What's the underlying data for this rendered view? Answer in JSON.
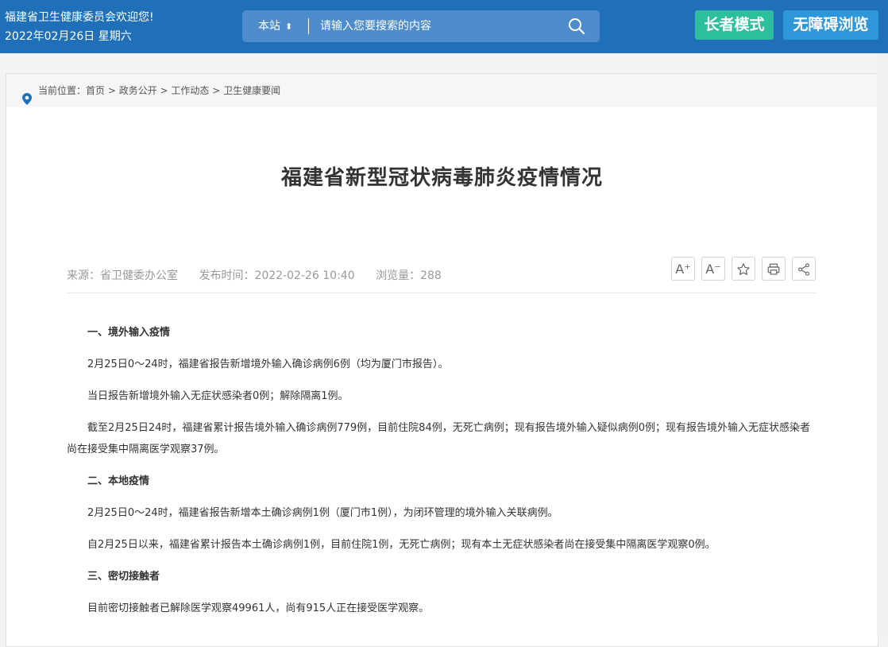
{
  "header": {
    "welcome": "福建省卫生健康委员会欢迎您!",
    "date": "2022年02月26日 星期六",
    "search_scope": "本站",
    "search_placeholder": "请输入您要搜索的内容",
    "elder_mode": "长者模式",
    "accessible": "无障碍浏览"
  },
  "breadcrumb": {
    "prefix": "当前位置：",
    "items": [
      "首页",
      "政务公开",
      "工作动态",
      "卫生健康要闻"
    ],
    "sep": " > "
  },
  "article": {
    "title": "福建省新型冠状病毒肺炎疫情情况",
    "source": "来源：省卫健委办公室",
    "published": "发布时间：2022-02-26 10:40",
    "views": "浏览量：288",
    "paragraphs": [
      {
        "type": "head",
        "text": "一、境外输入疫情"
      },
      {
        "type": "body",
        "text": "2月25日0～24时，福建省报告新增境外输入确诊病例6例（均为厦门市报告）。"
      },
      {
        "type": "body",
        "text": "当日报告新增境外输入无症状感染者0例；解除隔离1例。"
      },
      {
        "type": "body",
        "text": "截至2月25日24时，福建省累计报告境外输入确诊病例779例，目前住院84例，无死亡病例；现有报告境外输入疑似病例0例；现有报告境外输入无症状感染者尚在接受集中隔离医学观察37例。"
      },
      {
        "type": "head",
        "text": "二、本地疫情"
      },
      {
        "type": "body",
        "text": "2月25日0～24时，福建省报告新增本土确诊病例1例（厦门市1例），为闭环管理的境外输入关联病例。"
      },
      {
        "type": "body",
        "text": "自2月25日以来，福建省累计报告本土确诊病例1例，目前住院1例，无死亡病例；现有本土无症状感染者尚在接受集中隔离医学观察0例。"
      },
      {
        "type": "head",
        "text": "三、密切接触者"
      },
      {
        "type": "body",
        "text": "目前密切接触者已解除医学观察49961人，尚有915人正在接受医学观察。"
      }
    ]
  },
  "tools": {
    "font_increase": "A⁺",
    "font_decrease": "A⁻"
  },
  "colors": {
    "header_bg": "#1f6fb9",
    "elder_btn": "#2bbf9b",
    "access_btn": "#2d97d9"
  }
}
